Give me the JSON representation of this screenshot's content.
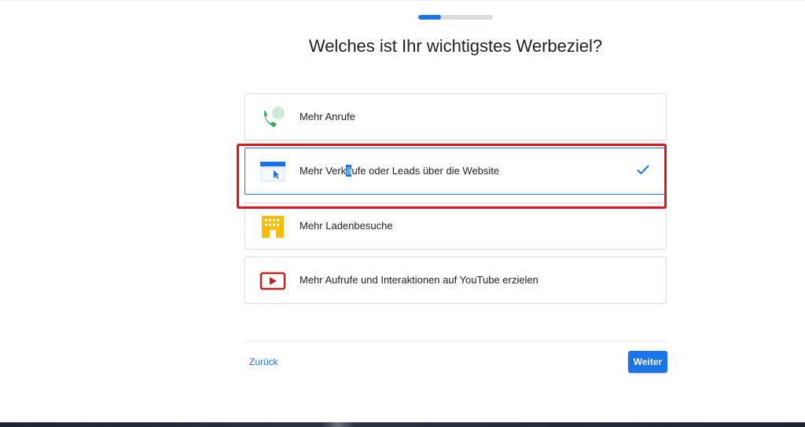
{
  "progress": {
    "value_fraction": 0.3
  },
  "page": {
    "title": "Welches ist Ihr wichtigstes Werbeziel?"
  },
  "options": [
    {
      "label": "Mehr Anrufe",
      "icon": "phone-icon",
      "selected": false
    },
    {
      "label_before_caret": "Mehr Verk",
      "label_caret": "ä",
      "label_after_caret": "ufe oder Leads über die Website",
      "icon": "website-icon",
      "selected": true
    },
    {
      "label": "Mehr Ladenbesuche",
      "icon": "store-icon",
      "selected": false
    },
    {
      "label": "Mehr Aufrufe und Interaktionen auf YouTube erzielen",
      "icon": "youtube-play-icon",
      "selected": false
    }
  ],
  "footer": {
    "back_label": "Zurück",
    "next_label": "Weiter"
  },
  "colors": {
    "accent": "#1a73e8",
    "highlight": "#e0161f",
    "phone_green": "#34a853",
    "store_yellow": "#fbbc04",
    "youtube_red": "#c5221f"
  }
}
